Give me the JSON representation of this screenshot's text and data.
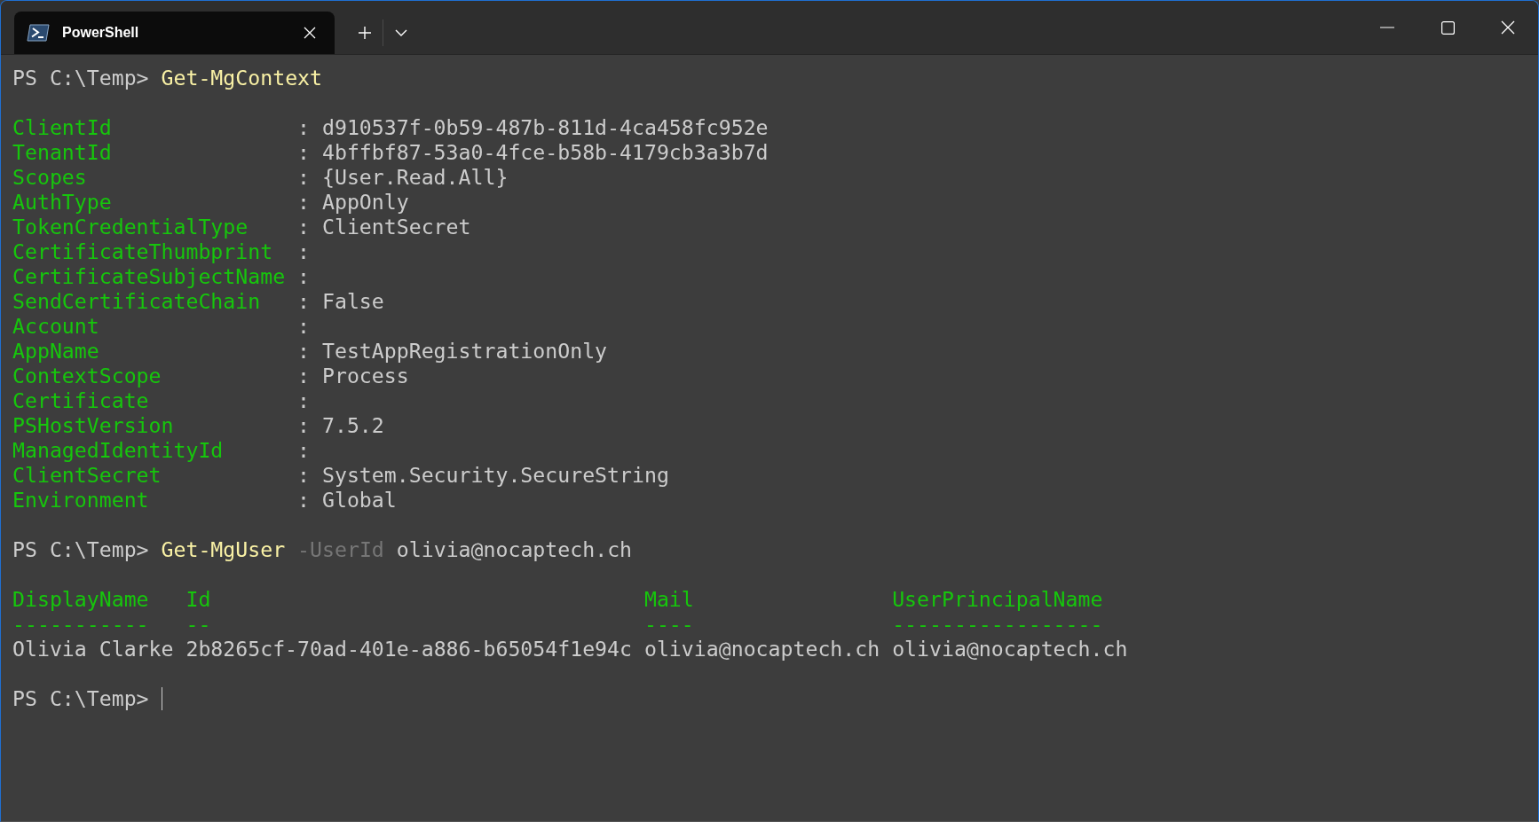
{
  "tabs": [
    {
      "title": "PowerShell",
      "selected": true
    }
  ],
  "terminal": {
    "blocks": [
      {
        "kind": "command",
        "prompt": "PS C:\\Temp>",
        "command": "Get-MgContext"
      },
      {
        "kind": "list",
        "separator": ":",
        "items": [
          {
            "name": "ClientId",
            "value": "d910537f-0b59-487b-811d-4ca458fc952e"
          },
          {
            "name": "TenantId",
            "value": "4bffbf87-53a0-4fce-b58b-4179cb3a3b7d"
          },
          {
            "name": "Scopes",
            "value": "{User.Read.All}"
          },
          {
            "name": "AuthType",
            "value": "AppOnly"
          },
          {
            "name": "TokenCredentialType",
            "value": "ClientSecret"
          },
          {
            "name": "CertificateThumbprint"
          },
          {
            "name": "CertificateSubjectName"
          },
          {
            "name": "SendCertificateChain",
            "value": "False"
          },
          {
            "name": "Account"
          },
          {
            "name": "AppName",
            "value": "TestAppRegistrationOnly"
          },
          {
            "name": "ContextScope",
            "value": "Process"
          },
          {
            "name": "Certificate"
          },
          {
            "name": "PSHostVersion",
            "value": "7.5.2"
          },
          {
            "name": "ManagedIdentityId"
          },
          {
            "name": "ClientSecret",
            "value": "System.Security.SecureString"
          },
          {
            "name": "Environment",
            "value": "Global"
          }
        ]
      },
      {
        "kind": "command",
        "prompt": "PS C:\\Temp>",
        "command": "Get-MgUser",
        "parameter": "-UserId",
        "argument": "olivia@nocaptech.ch"
      },
      {
        "kind": "table",
        "columns": [
          {
            "header": "DisplayName",
            "rule": "-----------"
          },
          {
            "header": "Id",
            "rule": "--"
          },
          {
            "header": "Mail",
            "rule": "----"
          },
          {
            "header": "UserPrincipalName",
            "rule": "-----------------"
          }
        ],
        "rows": [
          [
            "Olivia Clarke",
            "2b8265cf-70ad-401e-a886-b65054f1e94c",
            "olivia@nocaptech.ch",
            "olivia@nocaptech.ch"
          ]
        ]
      },
      {
        "kind": "prompt",
        "prompt": "PS C:\\Temp>"
      }
    ]
  }
}
